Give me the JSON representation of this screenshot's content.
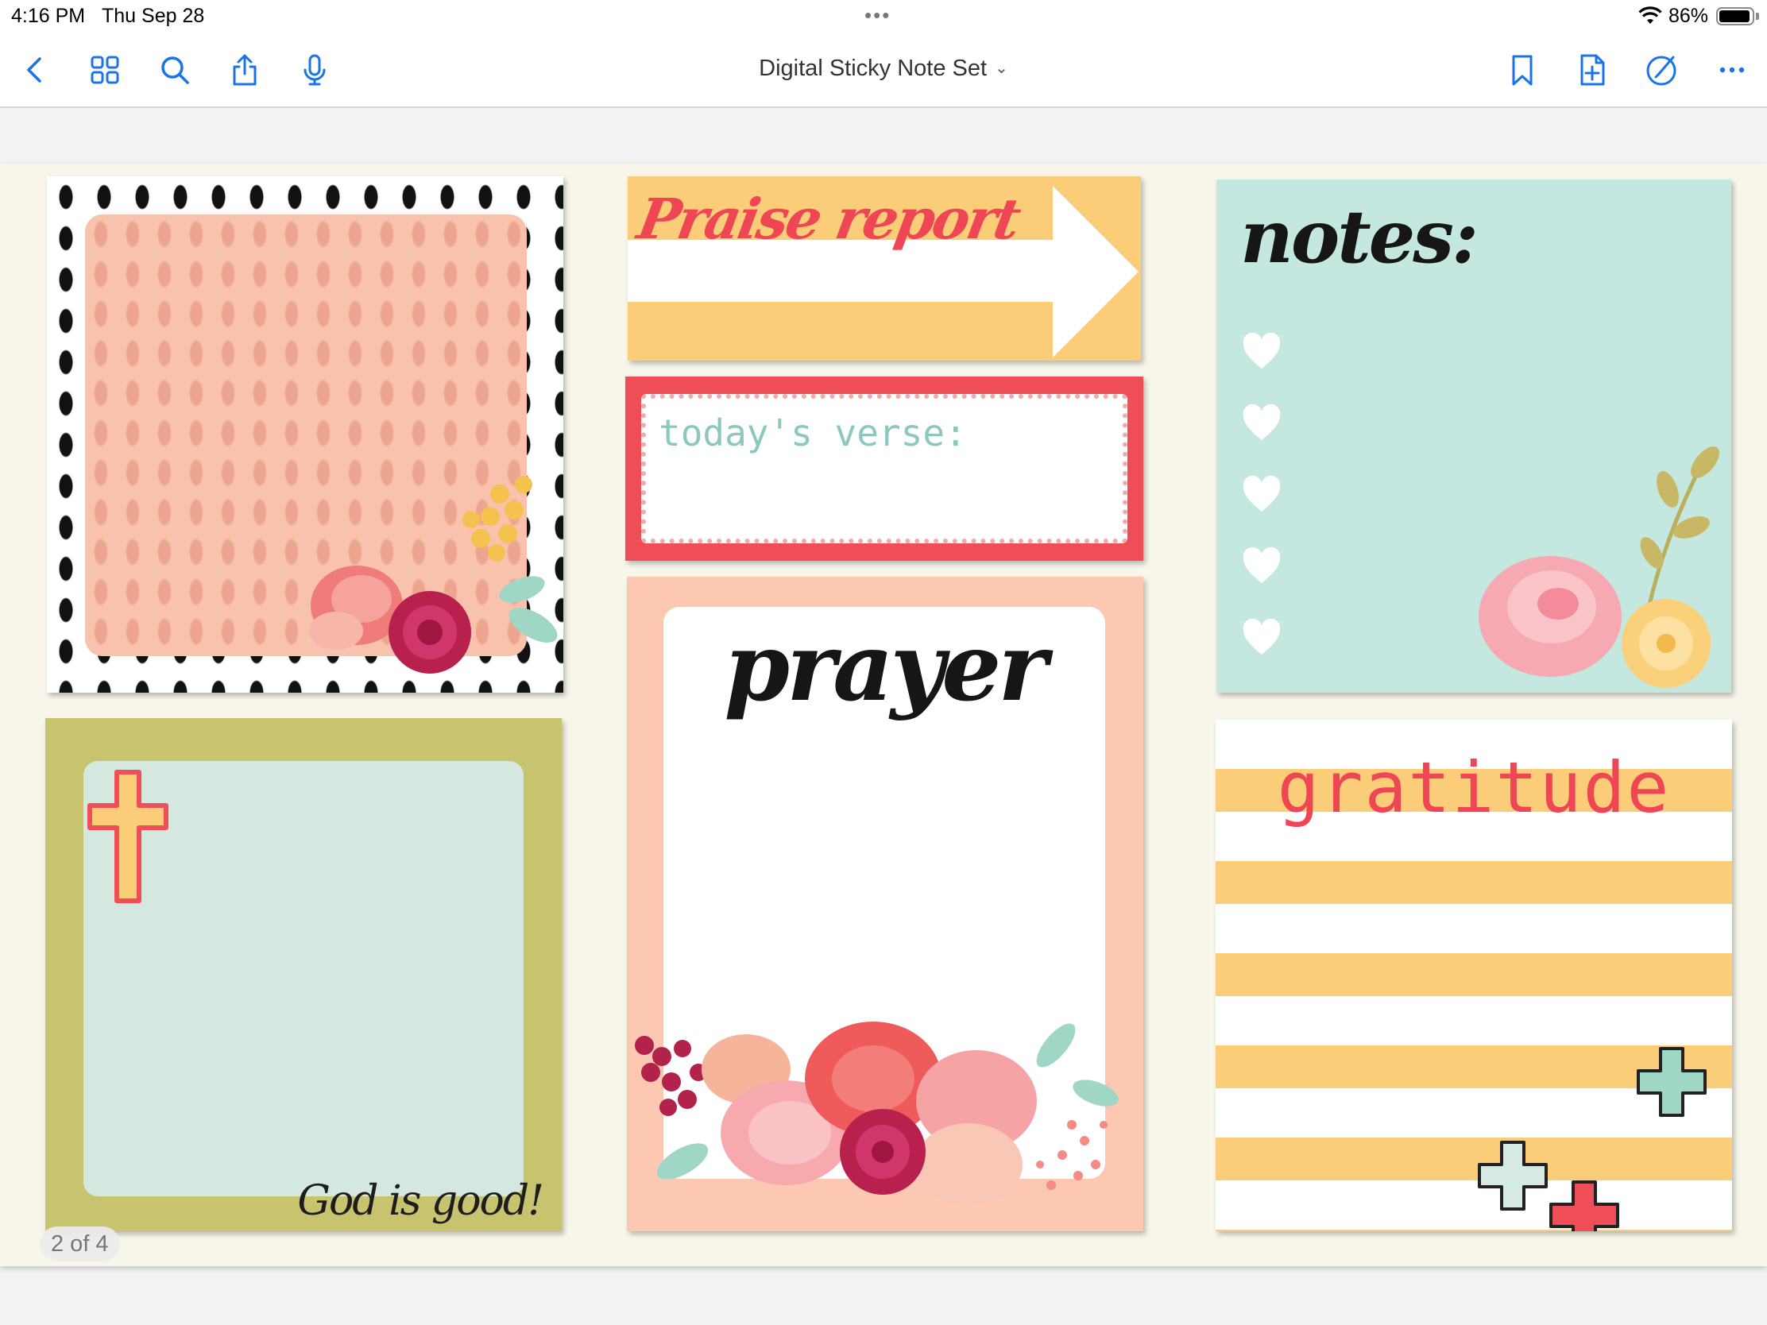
{
  "status_bar": {
    "time": "4:16 PM",
    "date": "Thu Sep 28",
    "battery_percent": "86%",
    "battery_level": 0.86
  },
  "toolbar": {
    "title": "Digital Sticky Note Set",
    "accent_color": "#1a73e8",
    "left_icons": [
      "back-chevron-icon",
      "grid-icon",
      "search-icon",
      "share-icon",
      "microphone-icon"
    ],
    "right_icons": [
      "bookmark-icon",
      "add-page-icon",
      "markup-icon",
      "more-icon"
    ]
  },
  "notes": {
    "praise": {
      "title": "Praise report"
    },
    "verse": {
      "title": "today's verse:"
    },
    "prayer": {
      "title": "prayer"
    },
    "notes": {
      "title": "notes:"
    },
    "cross_card": {
      "caption": "God is good!"
    },
    "gratitude": {
      "title": "gratitude"
    }
  },
  "page_indicator": "2 of 4",
  "colors": {
    "coral": "#ef4655",
    "peach": "#f8c2ad",
    "yellow": "#fbcd78",
    "mint": "#c4e7df",
    "olive": "#c8c36f"
  }
}
